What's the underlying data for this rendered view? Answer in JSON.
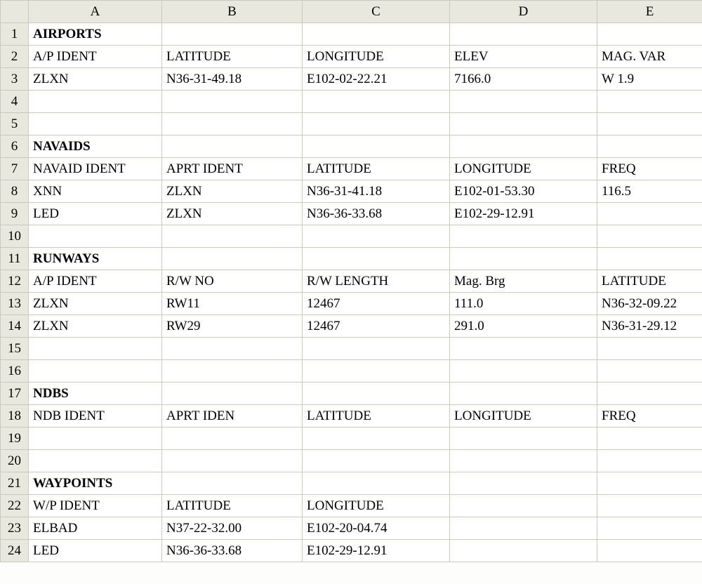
{
  "columns": [
    "A",
    "B",
    "C",
    "D",
    "E"
  ],
  "rows": [
    {
      "num": "1",
      "bold": true,
      "cells": [
        "AIRPORTS",
        "",
        "",
        "",
        ""
      ]
    },
    {
      "num": "2",
      "bold": false,
      "cells": [
        "A/P IDENT",
        "LATITUDE",
        "LONGITUDE",
        "ELEV",
        "MAG. VAR"
      ]
    },
    {
      "num": "3",
      "bold": false,
      "cells": [
        "ZLXN",
        "N36-31-49.18",
        "E102-02-22.21",
        "7166.0",
        "W 1.9"
      ]
    },
    {
      "num": "4",
      "bold": false,
      "cells": [
        "",
        "",
        "",
        "",
        ""
      ]
    },
    {
      "num": "5",
      "bold": false,
      "cells": [
        "",
        "",
        "",
        "",
        ""
      ]
    },
    {
      "num": "6",
      "bold": true,
      "cells": [
        "NAVAIDS",
        "",
        "",
        "",
        ""
      ]
    },
    {
      "num": "7",
      "bold": false,
      "cells": [
        "NAVAID IDENT",
        "APRT IDENT",
        "LATITUDE",
        "LONGITUDE",
        "FREQ"
      ]
    },
    {
      "num": "8",
      "bold": false,
      "cells": [
        "XNN",
        "ZLXN",
        "N36-31-41.18",
        "E102-01-53.30",
        "116.5"
      ]
    },
    {
      "num": "9",
      "bold": false,
      "cells": [
        "LED",
        "ZLXN",
        "N36-36-33.68",
        "E102-29-12.91",
        ""
      ]
    },
    {
      "num": "10",
      "bold": false,
      "cells": [
        "",
        "",
        "",
        "",
        ""
      ]
    },
    {
      "num": "11",
      "bold": true,
      "cells": [
        "RUNWAYS",
        "",
        "",
        "",
        ""
      ]
    },
    {
      "num": "12",
      "bold": false,
      "cells": [
        "A/P IDENT",
        "R/W NO",
        "R/W LENGTH",
        "Mag. Brg",
        "LATITUDE"
      ]
    },
    {
      "num": "13",
      "bold": false,
      "cells": [
        "ZLXN",
        "RW11",
        "12467",
        "111.0",
        "N36-32-09.22"
      ]
    },
    {
      "num": "14",
      "bold": false,
      "cells": [
        "ZLXN",
        "RW29",
        "12467",
        "291.0",
        "N36-31-29.12"
      ]
    },
    {
      "num": "15",
      "bold": false,
      "cells": [
        "",
        "",
        "",
        "",
        ""
      ]
    },
    {
      "num": "16",
      "bold": false,
      "cells": [
        "",
        "",
        "",
        "",
        ""
      ]
    },
    {
      "num": "17",
      "bold": true,
      "cells": [
        "NDBS",
        "",
        "",
        "",
        ""
      ]
    },
    {
      "num": "18",
      "bold": false,
      "cells": [
        "NDB IDENT",
        "APRT IDEN",
        "LATITUDE",
        "LONGITUDE",
        "FREQ"
      ]
    },
    {
      "num": "19",
      "bold": false,
      "cells": [
        "",
        "",
        "",
        "",
        ""
      ]
    },
    {
      "num": "20",
      "bold": false,
      "cells": [
        "",
        "",
        "",
        "",
        ""
      ]
    },
    {
      "num": "21",
      "bold": true,
      "cells": [
        "WAYPOINTS",
        "",
        "",
        "",
        ""
      ]
    },
    {
      "num": "22",
      "bold": false,
      "cells": [
        "W/P IDENT",
        "LATITUDE",
        "LONGITUDE",
        "",
        ""
      ]
    },
    {
      "num": "23",
      "bold": false,
      "cells": [
        "ELBAD",
        "N37-22-32.00",
        "E102-20-04.74",
        "",
        ""
      ]
    },
    {
      "num": "24",
      "bold": false,
      "cells": [
        "LED",
        "N36-36-33.68",
        "E102-29-12.91",
        "",
        ""
      ]
    }
  ]
}
